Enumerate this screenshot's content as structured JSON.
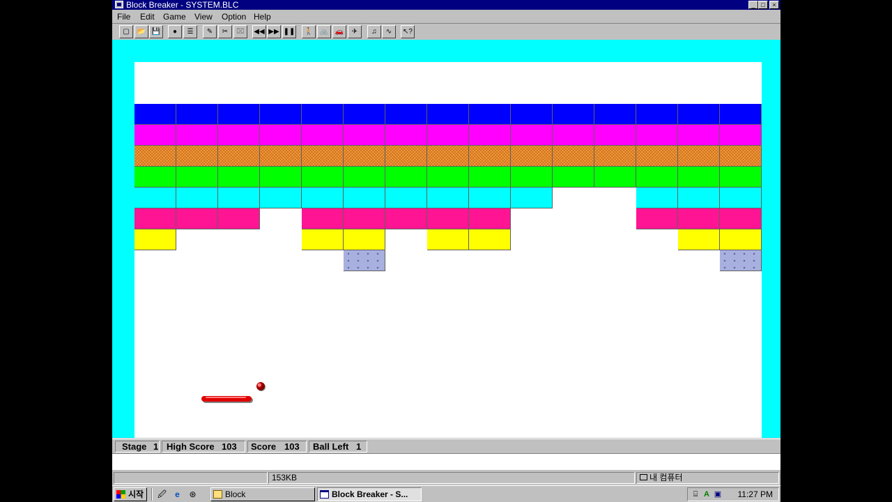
{
  "window": {
    "title": "Block Breaker - SYSTEM.BLC",
    "buttons": {
      "minimize": "_",
      "maximize": "□",
      "close": "×"
    }
  },
  "menu": [
    "File",
    "Edit",
    "Game",
    "View",
    "Option",
    "Help"
  ],
  "toolbar": [
    {
      "icon": "new-icon",
      "glyph": "▢"
    },
    {
      "icon": "open-icon",
      "glyph": "📂"
    },
    {
      "icon": "save-icon",
      "glyph": "💾"
    },
    {
      "icon": "record-icon",
      "glyph": "●"
    },
    {
      "icon": "list-icon",
      "glyph": "☰"
    },
    {
      "icon": "edit-pen-icon",
      "glyph": "✎"
    },
    {
      "icon": "tools-icon",
      "glyph": "✂"
    },
    {
      "icon": "clear-icon",
      "glyph": "⌧"
    },
    {
      "icon": "rewind-icon",
      "glyph": "◀◀"
    },
    {
      "icon": "fast-forward-icon",
      "glyph": "▶▶"
    },
    {
      "icon": "pause-icon",
      "glyph": "❚❚"
    },
    {
      "icon": "walk-icon",
      "glyph": "🚶"
    },
    {
      "icon": "bicycle-icon",
      "glyph": "🚲"
    },
    {
      "icon": "car-icon",
      "glyph": "🚗"
    },
    {
      "icon": "airplane-icon",
      "glyph": "✈"
    },
    {
      "icon": "music-icon",
      "glyph": "♫"
    },
    {
      "icon": "sound-wave-icon",
      "glyph": "∿"
    },
    {
      "icon": "help-cursor-icon",
      "glyph": "↖?"
    }
  ],
  "colors": {
    "blue": "#0000ff",
    "magenta": "#ff00ff",
    "orange": "#ff9933",
    "green": "#00ff00",
    "cyan": "#00ffff",
    "pink": "#ff1493",
    "yellow": "#ffff00",
    "lavender": "#a8b0e0"
  },
  "rows": [
    {
      "color": "blue",
      "cols": [
        0,
        1,
        2,
        3,
        4,
        5,
        6,
        7,
        8,
        9,
        10,
        11,
        12,
        13,
        14
      ]
    },
    {
      "color": "magenta",
      "cols": [
        0,
        1,
        2,
        3,
        4,
        5,
        6,
        7,
        8,
        9,
        10,
        11,
        12,
        13,
        14
      ]
    },
    {
      "color": "orange",
      "pattern": "hatch",
      "cols": [
        0,
        1,
        2,
        3,
        4,
        5,
        6,
        7,
        8,
        9,
        10,
        11,
        12,
        13,
        14
      ]
    },
    {
      "color": "green",
      "cols": [
        0,
        1,
        2,
        3,
        4,
        5,
        6,
        7,
        8,
        9,
        10,
        11,
        12,
        13,
        14
      ]
    },
    {
      "color": "cyan",
      "cols": [
        0,
        1,
        2,
        3,
        4,
        5,
        6,
        7,
        8,
        9,
        12,
        13,
        14
      ]
    },
    {
      "color": "pink",
      "cols": [
        0,
        1,
        2,
        4,
        5,
        6,
        7,
        8,
        12,
        13,
        14
      ]
    },
    {
      "color": "yellow",
      "cols": [
        0,
        4,
        5,
        7,
        8,
        13,
        14
      ]
    },
    {
      "color": "lavender",
      "pattern": "dots",
      "cols": [
        5,
        14
      ]
    }
  ],
  "status": {
    "stage_label": "Stage",
    "stage_value": "1",
    "high_label": "High Score",
    "high_value": "103",
    "score_label": "Score",
    "score_value": "103",
    "balls_label": "Ball Left",
    "balls_value": "1"
  },
  "explorer_status": {
    "size": "153KB",
    "location": "내 컴퓨터"
  },
  "taskbar": {
    "start": "시작",
    "quick_launch": [
      "desktop-icon",
      "ie-icon",
      "channels-icon"
    ],
    "tasks": [
      {
        "label": "Block",
        "icon": "folder-icon",
        "active": false
      },
      {
        "label": "Block Breaker - S...",
        "icon": "app-window-icon",
        "active": true
      }
    ],
    "clock": "11:27 PM"
  }
}
